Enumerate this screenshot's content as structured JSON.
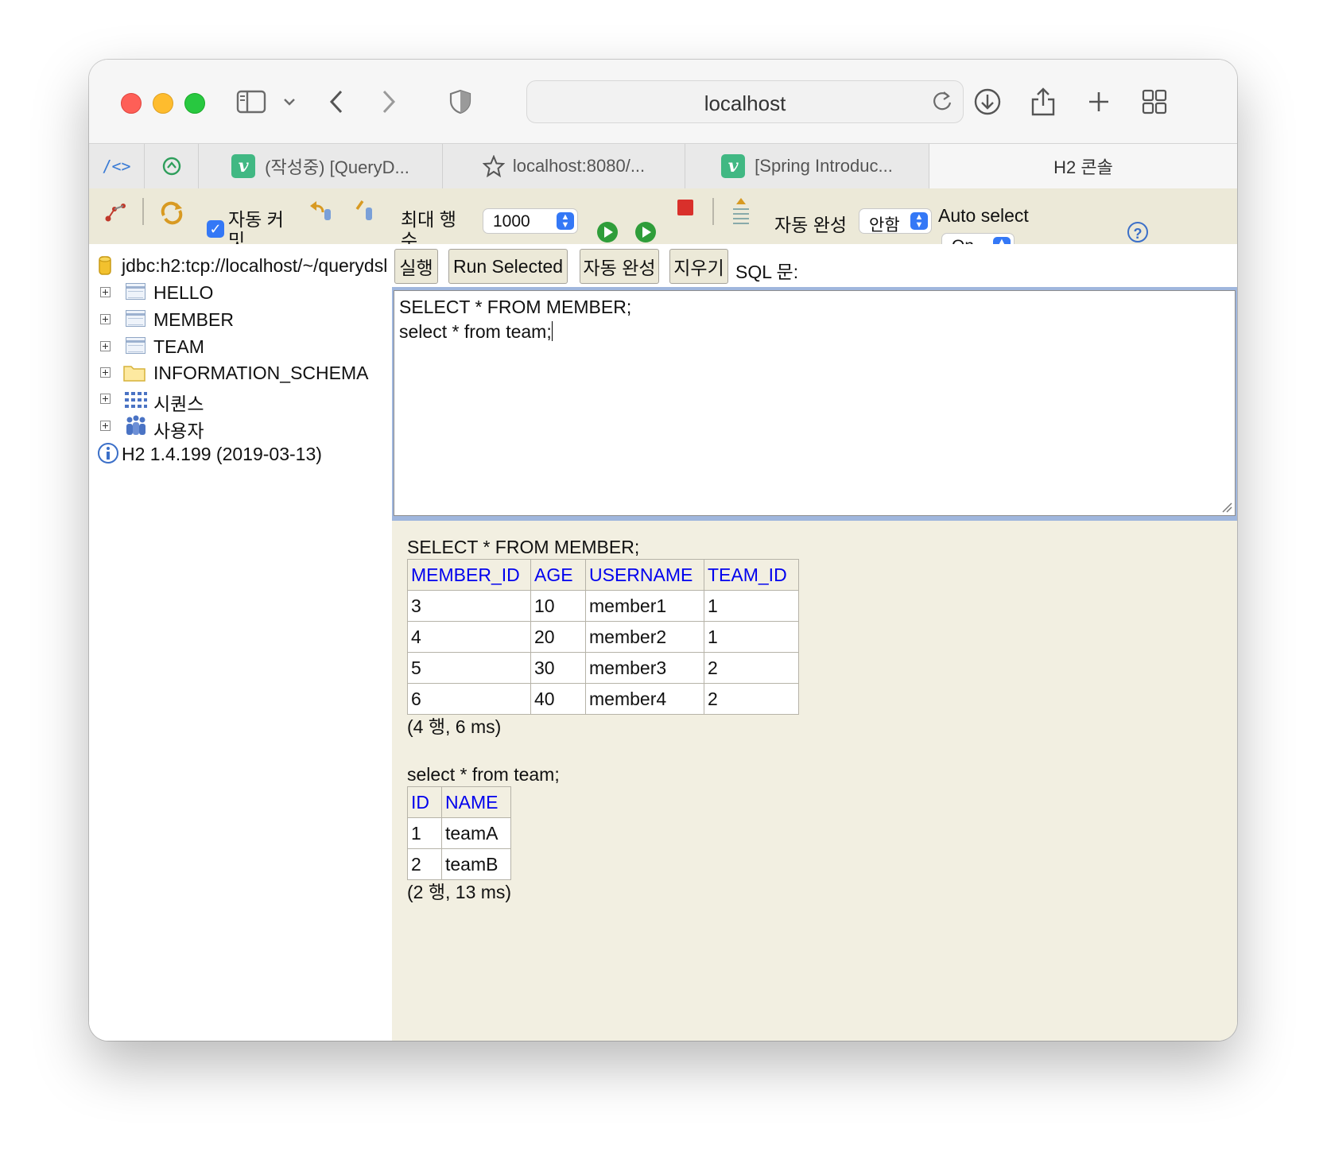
{
  "browser": {
    "address": "localhost",
    "tabs": [
      {
        "label": "(작성중) [QueryD...",
        "icon": "vue-icon"
      },
      {
        "label": "localhost:8080/...",
        "icon": "star-icon"
      },
      {
        "label": "[Spring Introduc...",
        "icon": "vue-icon"
      },
      {
        "label": "H2 콘솔",
        "icon": null
      }
    ]
  },
  "toolbar": {
    "auto_commit_label": "자동 커밋",
    "max_rows_label": "최대 행 수",
    "max_rows_value": "1000",
    "autocomplete_label": "자동 완성",
    "autocomplete_value": "안함",
    "auto_select_label": "Auto select",
    "auto_select_value": "On",
    "help_glyph": "?"
  },
  "tree": {
    "connection": "jdbc:h2:tcp://localhost/~/querydsl",
    "items": [
      {
        "label": "HELLO",
        "type": "table"
      },
      {
        "label": "MEMBER",
        "type": "table"
      },
      {
        "label": "TEAM",
        "type": "table"
      },
      {
        "label": "INFORMATION_SCHEMA",
        "type": "folder"
      },
      {
        "label": "시퀀스",
        "type": "sequences"
      },
      {
        "label": "사용자",
        "type": "users"
      }
    ],
    "version": "H2 1.4.199 (2019-03-13)"
  },
  "commands": {
    "run": "실행",
    "run_selected": "Run Selected",
    "autocomplete": "자동 완성",
    "clear": "지우기",
    "sql_label": "SQL 문:"
  },
  "editor": {
    "line1": "SELECT * FROM MEMBER;",
    "line2": "select * from team;"
  },
  "results": [
    {
      "query": "SELECT * FROM MEMBER;",
      "columns": [
        "MEMBER_ID",
        "AGE",
        "USERNAME",
        "TEAM_ID"
      ],
      "rows": [
        [
          "3",
          "10",
          "member1",
          "1"
        ],
        [
          "4",
          "20",
          "member2",
          "1"
        ],
        [
          "5",
          "30",
          "member3",
          "2"
        ],
        [
          "6",
          "40",
          "member4",
          "2"
        ]
      ],
      "summary": "(4 행, 6 ms)"
    },
    {
      "query": "select * from team;",
      "columns": [
        "ID",
        "NAME"
      ],
      "rows": [
        [
          "1",
          "teamA"
        ],
        [
          "2",
          "teamB"
        ]
      ],
      "summary": "(2 행, 13 ms)"
    }
  ],
  "colors": {
    "panel": "#f2efe1",
    "toolbar": "#ece9d8",
    "header_link": "#0000ee",
    "accent": "#3478f6"
  }
}
